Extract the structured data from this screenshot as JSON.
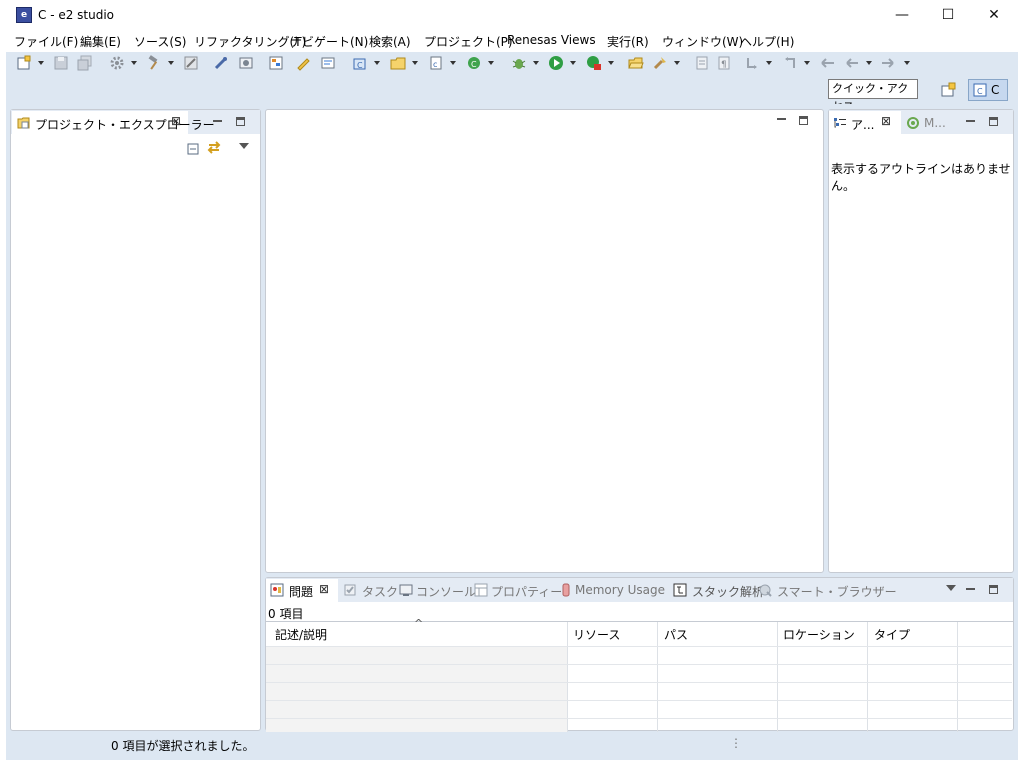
{
  "window": {
    "title": "C - e2 studio",
    "minimize": "—",
    "maximize": "☐",
    "close": "✕"
  },
  "menu": [
    "ファイル(F)",
    "編集(E)",
    "ソース(S)",
    "リファクタリング(T)",
    "ナビゲート(N)",
    "検索(A)",
    "プロジェクト(P)",
    "Renesas Views",
    "実行(R)",
    "ウィンドウ(W)",
    "ヘルプ(H)"
  ],
  "toolbar": {
    "quick_access": "クイック・アクセス",
    "perspective_label": "C"
  },
  "project_explorer": {
    "tab_label": "プロジェクト・エクスプローラー"
  },
  "outline": {
    "tab_label": "ア...",
    "second_tab_label": "M...",
    "empty_message": "表示するアウトラインはありません。"
  },
  "bottom_panel": {
    "tabs": [
      "問題",
      "タスク",
      "コンソール",
      "プロパティー",
      "Memory Usage",
      "スタック解析",
      "スマート・ブラウザー"
    ],
    "item_count": "0 項目",
    "columns": [
      "記述/説明",
      "リソース",
      "パス",
      "ロケーション",
      "タイプ"
    ]
  },
  "status": {
    "text": "0 項目が選択されました。"
  },
  "colors": {
    "workbench": "#dde7f2",
    "border": "#c6cbd3",
    "accent": "#3b4fa0"
  }
}
